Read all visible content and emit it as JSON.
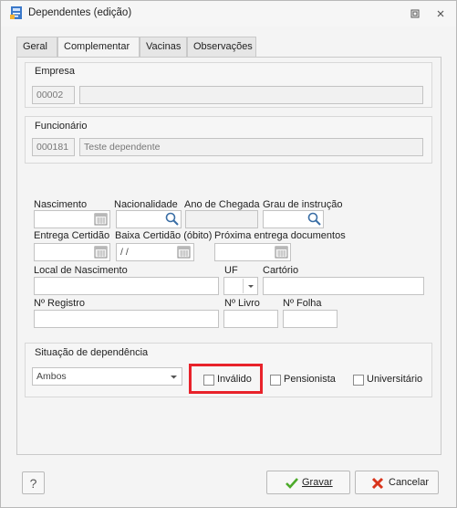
{
  "window": {
    "title": "Dependentes (edição)"
  },
  "tabs": [
    "Geral",
    "Complementar",
    "Vacinas",
    "Observações"
  ],
  "empresa": {
    "label": "Empresa",
    "code": "00002",
    "name": ""
  },
  "funcionario": {
    "label": "Funcionário",
    "code": "000181",
    "name": "Teste dependente"
  },
  "fields": {
    "nascimento": "Nascimento",
    "nacionalidade": "Nacionalidade",
    "ano_chegada": "Ano de Chegada",
    "grau_instrucao": "Grau de instrução",
    "entrega_certidao": "Entrega Certidão",
    "baixa_certidao": "Baixa Certidão (óbito)",
    "baixa_certidao_value": "/ /",
    "proxima_entrega": "Próxima entrega documentos",
    "local_nascimento": "Local de Nascimento",
    "uf": "UF",
    "cartorio": "Cartório",
    "n_registro": "Nº Registro",
    "n_livro": "Nº Livro",
    "n_folha": "Nº Folha"
  },
  "situacao": {
    "label": "Situação de dependência",
    "selected": "Ambos",
    "invalido": "Inválido",
    "pensionista": "Pensionista",
    "universitario": "Universitário"
  },
  "buttons": {
    "help": "?",
    "gravar": "Gravar",
    "cancelar": "Cancelar"
  }
}
